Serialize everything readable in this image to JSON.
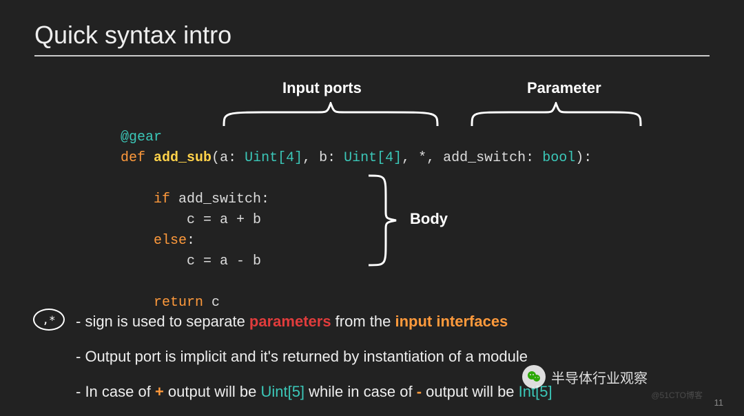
{
  "title": "Quick syntax intro",
  "labels": {
    "input": "Input ports",
    "param": "Parameter",
    "body": "Body"
  },
  "code": {
    "decorator": "@gear",
    "def": "def",
    "fn": "add_sub",
    "sig_open": "(",
    "p1": "a: ",
    "t1": "Uint[4]",
    "c1": ", ",
    "p2": "b: ",
    "t2": "Uint[4]",
    "c2": ", *, ",
    "p3": "add_switch: ",
    "t3": "bool",
    "sig_close": "):",
    "if": "if",
    "ifcond": " add_switch:",
    "body1": "        c = a + b",
    "else": "else",
    "elsec": ":",
    "body2": "        c = a - b",
    "ret": "return",
    "retv": " c"
  },
  "star": ",*",
  "bullets": {
    "b1a": "- sign is used to separate ",
    "b1b": "parameters",
    "b1c": " from the ",
    "b1d": "input interfaces",
    "b2": "- Output port is implicit and it's returned by instantiation of a module",
    "b3a": "- In case of ",
    "b3b": "+",
    "b3c": " output will be ",
    "b3d": "Uint[5]",
    "b3e": " while in case of ",
    "b3f": "-",
    "b3g": " output will be ",
    "b3h": "Int[5]"
  },
  "pagenum": "11",
  "watermark": "@51CTO博客",
  "wechat": "半导体行业观察"
}
